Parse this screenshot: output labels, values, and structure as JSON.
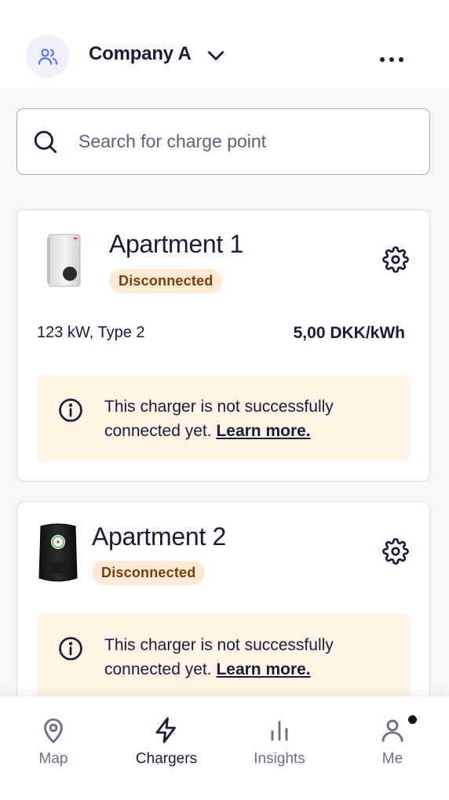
{
  "header": {
    "company_name": "Company A",
    "avatar_icon": "users-icon",
    "dropdown_icon": "chevron-down-icon",
    "more_icon": "more-horizontal-icon"
  },
  "search": {
    "placeholder": "Search for charge point",
    "value": ""
  },
  "chargers": [
    {
      "name": "Apartment 1",
      "status": "Disconnected",
      "specs": "123 kW, Type 2",
      "price": "5,00 DKK/kWh",
      "info_text": "This charger is not successfully connected yet.",
      "learn_more": "Learn more."
    },
    {
      "name": "Apartment 2",
      "status": "Disconnected",
      "info_text": "This charger is not successfully connected yet.",
      "learn_more": "Learn more."
    }
  ],
  "nav": {
    "items": [
      {
        "label": "Map",
        "icon": "map-pin-icon",
        "active": false
      },
      {
        "label": "Chargers",
        "icon": "lightning-icon",
        "active": true
      },
      {
        "label": "Insights",
        "icon": "bar-chart-icon",
        "active": false
      },
      {
        "label": "Me",
        "icon": "user-icon",
        "active": false,
        "has_notification": true
      }
    ]
  },
  "colors": {
    "primary_text": "#1a1b3a",
    "badge_bg": "#fde9d6",
    "badge_text": "#7a3e05",
    "info_bg": "#fff4e6",
    "accent": "#5b6cf0"
  }
}
